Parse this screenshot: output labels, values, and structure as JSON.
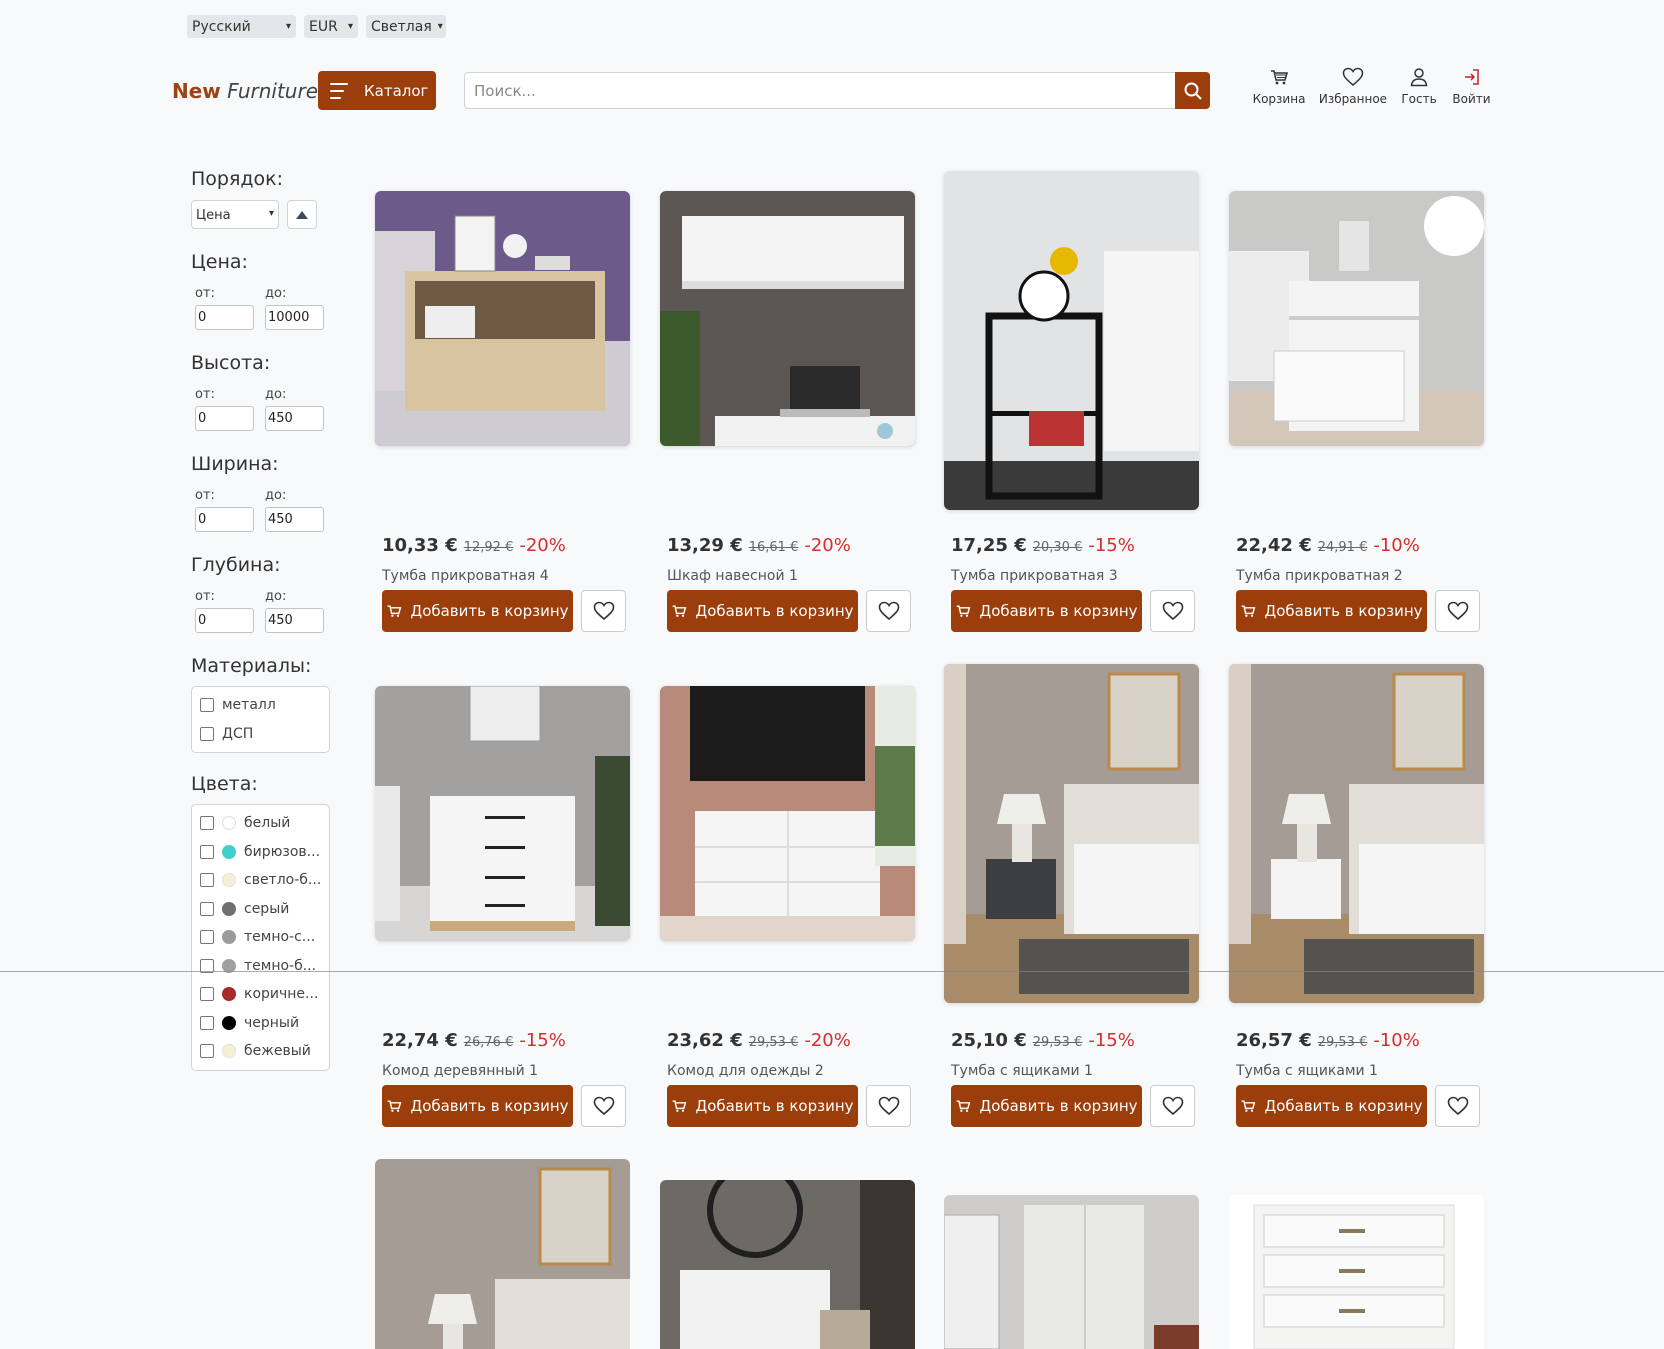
{
  "topbar": {
    "language": "Русский",
    "currency": "EUR",
    "theme": "Светлая"
  },
  "header": {
    "logo_new": "New",
    "logo_furniture": "Furniture",
    "catalog_label": "Каталог",
    "search_placeholder": "Поиск...",
    "icons": [
      {
        "icon": "cart-icon",
        "label": "Корзина"
      },
      {
        "icon": "heart-icon",
        "label": "Избранное"
      },
      {
        "icon": "user-icon",
        "label": "Гость"
      },
      {
        "icon": "login-icon",
        "label": "Войти"
      }
    ]
  },
  "filters": {
    "order_title": "Порядок:",
    "order_value": "Цена",
    "price_title": "Цена:",
    "price_from": "0",
    "price_to": "10000",
    "height_title": "Высота:",
    "height_from": "0",
    "height_to": "450",
    "width_title": "Ширина:",
    "width_from": "0",
    "width_to": "450",
    "depth_title": "Глубина:",
    "depth_from": "0",
    "depth_to": "450",
    "from_label": "от:",
    "to_label": "до:",
    "materials_title": "Материалы:",
    "materials": [
      "металл",
      "ДСП"
    ],
    "colors_title": "Цвета:",
    "colors": [
      {
        "name": "белый",
        "color": "#ffffff"
      },
      {
        "name": "бирюзов...",
        "color": "#3fd0c9"
      },
      {
        "name": "светло-б...",
        "color": "#f3f0d8"
      },
      {
        "name": "серый",
        "color": "#6f6f6f"
      },
      {
        "name": "темно-с...",
        "color": "#9a9a9a"
      },
      {
        "name": "темно-б...",
        "color": "#a0a0a0"
      },
      {
        "name": "коричне...",
        "color": "#a52a2a"
      },
      {
        "name": "черный",
        "color": "#000000"
      },
      {
        "name": "бежевый",
        "color": "#f5f0d6"
      }
    ]
  },
  "product_buttons": {
    "add_to_cart": "Добавить в корзину"
  },
  "products": [
    {
      "price": "10,33 €",
      "old_price": "12,92 €",
      "discount": "-20%",
      "name": "Тумба прикроватная 4"
    },
    {
      "price": "13,29 €",
      "old_price": "16,61 €",
      "discount": "-20%",
      "name": "Шкаф навесной 1"
    },
    {
      "price": "17,25 €",
      "old_price": "20,30 €",
      "discount": "-15%",
      "name": "Тумба прикроватная 3"
    },
    {
      "price": "22,42 €",
      "old_price": "24,91 €",
      "discount": "-10%",
      "name": "Тумба прикроватная 2"
    },
    {
      "price": "22,74 €",
      "old_price": "26,76 €",
      "discount": "-15%",
      "name": "Комод деревянный 1"
    },
    {
      "price": "23,62 €",
      "old_price": "29,53 €",
      "discount": "-20%",
      "name": "Комод для одежды 2"
    },
    {
      "price": "25,10 €",
      "old_price": "29,53 €",
      "discount": "-15%",
      "name": "Тумба с ящиками 1"
    },
    {
      "price": "26,57 €",
      "old_price": "29,53 €",
      "discount": "-10%",
      "name": "Тумба с ящиками 1"
    }
  ]
}
